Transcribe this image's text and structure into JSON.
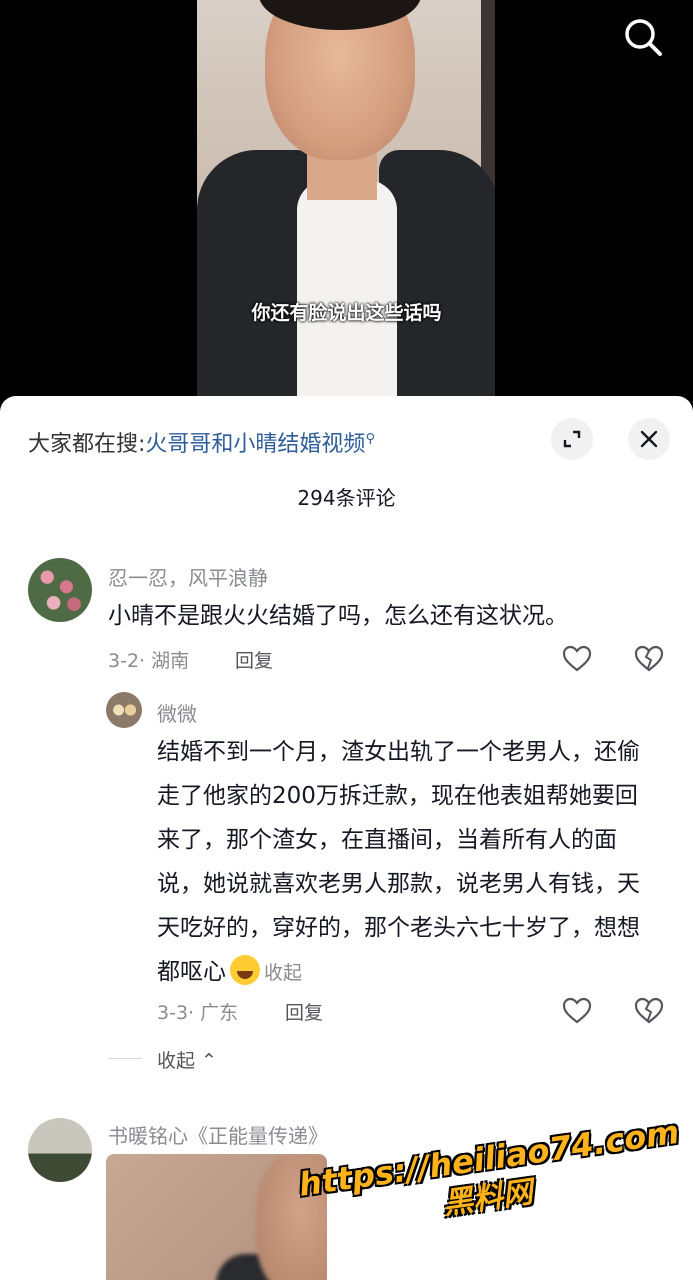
{
  "video": {
    "subtitle": "你还有脸说出这些话吗"
  },
  "sheet": {
    "hot_search_prefix": "大家都在搜:",
    "hot_search_term": "火哥哥和小晴结婚视频",
    "comment_count": "294条评论"
  },
  "comments": [
    {
      "name": "忍一忍，风平浪静",
      "text": "小晴不是跟火火结婚了吗，怎么还有这状况。",
      "meta": "3-2· 湖南",
      "reply": "回复"
    },
    {
      "name": "微微",
      "text": "结婚不到一个月，渣女出轨了一个老男人，还偷走了他家的200万拆迁款，现在他表姐帮她要回来了，那个渣女，在直播间，当着所有人的面说，她说就喜欢老男人那款，说老男人有钱，天天吃好的，穿好的，那个老头六七十岁了，想想都呕心",
      "collapse": "收起",
      "meta": "3-3· 广东",
      "reply": "回复"
    },
    {
      "name": "书暖铭心《正能量传递》"
    }
  ],
  "thread": {
    "fold_label": "收起 ⌃"
  },
  "watermark": {
    "url": "https://heiliao74.com",
    "label": "黑料网"
  },
  "colors": {
    "link": "#2f5d9a",
    "meta": "#8a8b91",
    "watermark": "#ffb21a"
  }
}
